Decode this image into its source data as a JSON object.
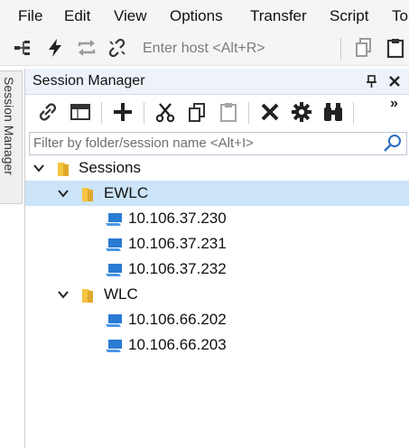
{
  "menubar": {
    "items": [
      {
        "label": "File"
      },
      {
        "label": "Edit"
      },
      {
        "label": "View"
      },
      {
        "label": "Options"
      },
      {
        "label": "Transfer"
      },
      {
        "label": "Script"
      },
      {
        "label": "To"
      }
    ]
  },
  "toolbar": {
    "host_placeholder": "Enter host <Alt+R>",
    "icons": [
      "connect-tree-icon",
      "lightning-icon",
      "reconnect-icon",
      "disconnect-icon",
      "copy-icon",
      "paste-icon"
    ]
  },
  "side_tab": {
    "label": "Session Manager"
  },
  "session_manager": {
    "title": "Session Manager",
    "filter_placeholder": "Filter by folder/session name <Alt+I>",
    "more_label": "»",
    "toolbar_icons": [
      "link-icon",
      "tabbed-window-icon",
      "plus-icon",
      "cut-icon",
      "copy-icon",
      "paste-icon",
      "delete-icon",
      "gear-icon",
      "binoculars-icon"
    ],
    "tree": {
      "root": {
        "label": "Sessions",
        "expanded": true
      },
      "folders": [
        {
          "label": "EWLC",
          "expanded": true,
          "selected": true,
          "sessions": [
            {
              "label": "10.106.37.230"
            },
            {
              "label": "10.106.37.231"
            },
            {
              "label": "10.106.37.232"
            }
          ]
        },
        {
          "label": "WLC",
          "expanded": true,
          "selected": false,
          "sessions": [
            {
              "label": "10.106.66.202"
            },
            {
              "label": "10.106.66.203"
            }
          ]
        }
      ]
    }
  },
  "colors": {
    "selection": "#cce4f7",
    "folder": "#f5c542",
    "monitor": "#2a7bd3",
    "title_bar": "#eef2fb"
  }
}
